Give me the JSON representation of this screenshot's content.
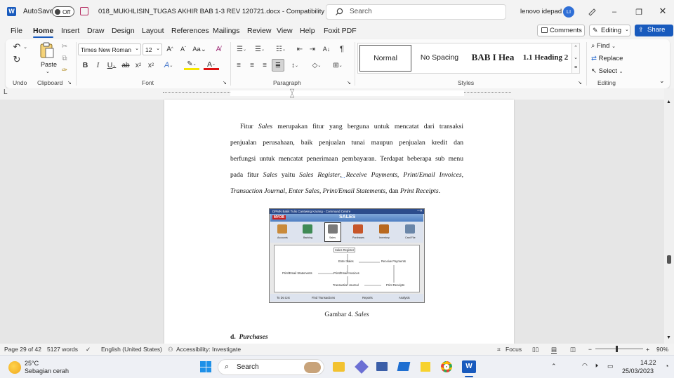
{
  "titlebar": {
    "autosave_label": "AutoSave",
    "autosave_state": "Off",
    "doc_title": "018_MUKHLISIN_TUGAS AKHIR BAB 1-3 REV 120721.docx  -  Compatibility Mode",
    "search_placeholder": "Search",
    "user_name": "lenovo idepad",
    "user_initials": "LI"
  },
  "menu": {
    "tabs": [
      "File",
      "Home",
      "Insert",
      "Draw",
      "Design",
      "Layout",
      "References",
      "Mailings",
      "Review",
      "View",
      "Help",
      "Foxit PDF"
    ],
    "comments": "Comments",
    "editing": "Editing",
    "share": "Share"
  },
  "ribbon": {
    "undo_group": "Undo",
    "clipboard_group": "Clipboard",
    "paste": "Paste",
    "font_group": "Font",
    "font_name": "Times New Roman",
    "font_size": "12",
    "paragraph_group": "Paragraph",
    "styles_group": "Styles",
    "styles": [
      "Normal",
      "No Spacing",
      "BAB I  Hea",
      "1.1  Heading 2"
    ],
    "editing_group": "Editing",
    "find": "Find",
    "replace": "Replace",
    "select": "Select",
    "accent_color": "#185abd"
  },
  "document": {
    "lines": [
      [
        "Fitur ",
        "Sales",
        " merupakan fitur yang berguna untuk mencatat dari transaksi"
      ],
      [
        "penjualan perusahaan, baik penjualan tunai maupun penjualan kredit dan"
      ],
      [
        "berfungsi untuk mencatat penerimaan pembayaran. Terdapat beberapa sub menu"
      ],
      [
        "pada fitur ",
        "Sales",
        " yaitu ",
        "Sales Register",
        ", ",
        "Receive Payments, Print/Email Invoices,"
      ],
      [
        "Transaction Journal, Enter Sales, Print/Email Statements,",
        " dan ",
        "Print Receipts",
        "."
      ]
    ],
    "figure": {
      "window_title": "DPMN Batik Tulis Cantiwing Karang - Command Centre",
      "logo": "MYOB",
      "heading": "SALES",
      "modules": [
        "Accounts",
        "Banking",
        "Sales",
        "Purchases",
        "Inventory",
        "Card File"
      ],
      "nodes": [
        "Sales Register",
        "Enter Sales",
        "Receive Payments",
        "Print/Email Statements",
        "Print/Email Invoices",
        "Transaction Journal",
        "Print Receipts"
      ],
      "footer": [
        "To Do List",
        "Find Transactions",
        "Reports",
        "Analysis"
      ]
    },
    "caption_prefix": "Gambar 4. ",
    "caption_italic": "Sales",
    "heading_letter": "d.",
    "heading_text": "Purchases"
  },
  "status": {
    "page": "Page 29 of 42",
    "words": "5127 words",
    "language": "English (United States)",
    "accessibility": "Accessibility: Investigate",
    "focus": "Focus",
    "zoom": "90%"
  },
  "taskbar": {
    "temp": "25°C",
    "weather": "Sebagian cerah",
    "search": "Search",
    "time": "14.22",
    "date": "25/03/2023"
  }
}
